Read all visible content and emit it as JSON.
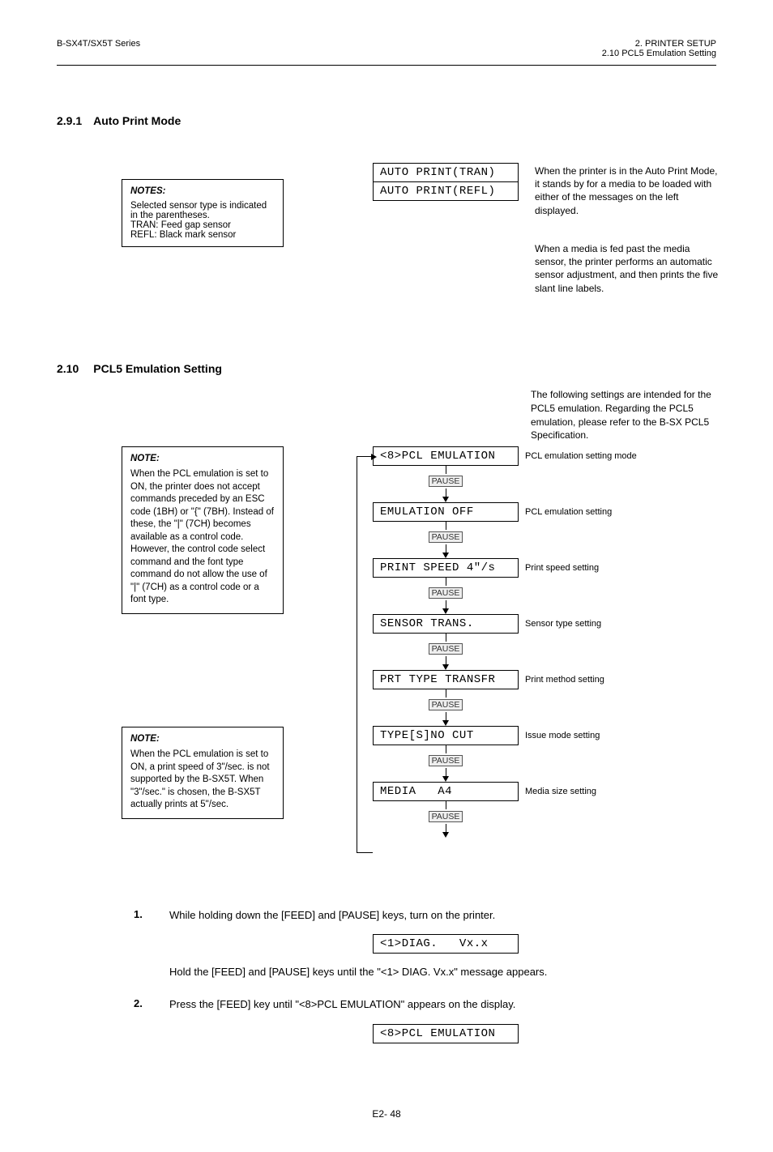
{
  "header": {
    "left": "B-SX4T/SX5T Series",
    "right_line": "2. PRINTER SETUP",
    "right_sub": "2.10 PCL5 Emulation Setting"
  },
  "section_2_9_1": {
    "num": "2.9.1",
    "title": "Auto Print Mode",
    "lcd_tran": "AUTO PRINT(TRAN)",
    "lcd_refl": "AUTO PRINT(REFL)",
    "body_1": "When the printer is in the Auto Print Mode, it stands by for a media to be loaded with either of the messages on the left displayed.",
    "body_2": "When a media is fed past the media sensor, the printer performs an automatic sensor adjustment, and then prints the five slant line labels.",
    "note_title": "NOTES:",
    "note_body": "Selected sensor type is indicated in the parentheses.\nTRAN: Feed gap sensor\nREFL: Black mark sensor"
  },
  "section_2_10": {
    "num": "2.10",
    "title": "PCL5 Emulation Setting",
    "body": "The following settings are intended for the PCL5 emulation. Regarding the PCL5 emulation, please refer to the B-SX PCL5 Specification.",
    "flow": {
      "b0": "<8>PCL EMULATION",
      "l0": "PCL emulation setting mode",
      "b1": "EMULATION OFF",
      "l1": "PCL emulation setting",
      "b2": "PRINT SPEED 4\"/s",
      "l2": "Print speed setting",
      "b3": "SENSOR TRANS.",
      "l3": "Sensor type setting",
      "b4": "PRT TYPE TRANSFR",
      "l4": "Print method setting",
      "b5": "TYPE[S]NO CUT",
      "l5": "Issue mode setting",
      "b6": "MEDIA   A4",
      "l6": "Media size setting"
    },
    "note1": {
      "title": "NOTE:",
      "body": "When the PCL emulation is set to ON, the printer does not accept commands preceded by an ESC code (1BH) or \"{\" (7BH).   Instead of these, the \"|\" (7CH) becomes available as a control code.  However, the control code select command and the font type command do not allow the use of \"|\" (7CH) as a control code or a font type."
    },
    "note2": {
      "title": "NOTE:",
      "body": "When the PCL emulation is set to ON, a print speed of 3\"/sec. is not supported by the B-SX5T.  When \"3\"/sec.\" is chosen, the B-SX5T actually prints at 5\"/sec."
    },
    "step1": {
      "num": "1.",
      "text_a": "While holding down the [FEED] and [PAUSE] keys, turn on the printer.",
      "lcd": "<1>DIAG.   Vx.x",
      "text_b": "Hold the [FEED] and [PAUSE] keys until the \"<1> DIAG.  Vx.x\" message appears."
    },
    "step2": {
      "num": "2.",
      "text": "Press the [FEED] key until \"<8>PCL EMULATION\" appears on the display.",
      "lcd": "<8>PCL EMULATION"
    }
  },
  "footer": {
    "page_num": "E2- 48"
  }
}
